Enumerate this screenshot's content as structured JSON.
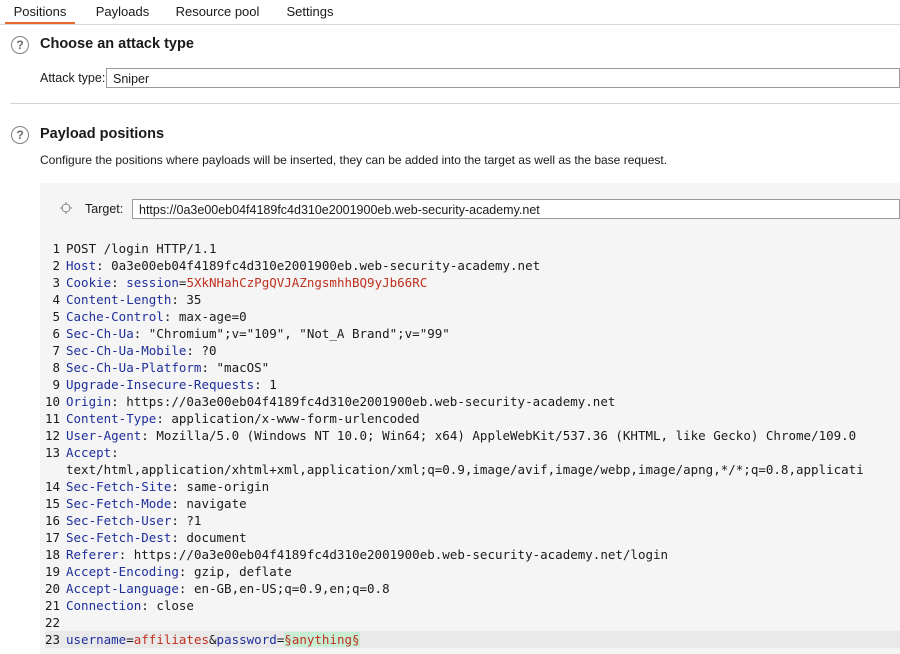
{
  "tabs": [
    {
      "label": "Positions",
      "active": true
    },
    {
      "label": "Payloads",
      "active": false
    },
    {
      "label": "Resource pool",
      "active": false
    },
    {
      "label": "Settings",
      "active": false
    }
  ],
  "help_icon_glyph": "?",
  "attack": {
    "title": "Choose an attack type",
    "type_label": "Attack type:",
    "type_value": "Sniper"
  },
  "positions": {
    "title": "Payload positions",
    "description": "Configure the positions where payloads will be inserted, they can be added into the target as well as the base request.",
    "target_label": "Target:",
    "target_value": "https://0a3e00eb04f4189fc4d310e2001900eb.web-security-academy.net"
  },
  "request_lines": [
    {
      "n": "1",
      "parts": [
        {
          "t": "POST /login HTTP/1.1",
          "c": "v"
        }
      ]
    },
    {
      "n": "2",
      "parts": [
        {
          "t": "Host",
          "c": "k"
        },
        {
          "t": ": 0a3e00eb04f4189fc4d310e2001900eb.web-security-academy.net",
          "c": "v"
        }
      ]
    },
    {
      "n": "3",
      "parts": [
        {
          "t": "Cookie",
          "c": "k"
        },
        {
          "t": ": ",
          "c": "v"
        },
        {
          "t": "session",
          "c": "k"
        },
        {
          "t": "=",
          "c": "v"
        },
        {
          "t": "5XkNHahCzPgQVJAZngsmhhBQ9yJb66RC",
          "c": "red"
        }
      ]
    },
    {
      "n": "4",
      "parts": [
        {
          "t": "Content-Length",
          "c": "k"
        },
        {
          "t": ": 35",
          "c": "v"
        }
      ]
    },
    {
      "n": "5",
      "parts": [
        {
          "t": "Cache-Control",
          "c": "k"
        },
        {
          "t": ": max-age=0",
          "c": "v"
        }
      ]
    },
    {
      "n": "6",
      "parts": [
        {
          "t": "Sec-Ch-Ua",
          "c": "k"
        },
        {
          "t": ": \"Chromium\";v=\"109\", \"Not_A Brand\";v=\"99\"",
          "c": "v"
        }
      ]
    },
    {
      "n": "7",
      "parts": [
        {
          "t": "Sec-Ch-Ua-Mobile",
          "c": "k"
        },
        {
          "t": ": ?0",
          "c": "v"
        }
      ]
    },
    {
      "n": "8",
      "parts": [
        {
          "t": "Sec-Ch-Ua-Platform",
          "c": "k"
        },
        {
          "t": ": \"macOS\"",
          "c": "v"
        }
      ]
    },
    {
      "n": "9",
      "parts": [
        {
          "t": "Upgrade-Insecure-Requests",
          "c": "k"
        },
        {
          "t": ": 1",
          "c": "v"
        }
      ]
    },
    {
      "n": "10",
      "parts": [
        {
          "t": "Origin",
          "c": "k"
        },
        {
          "t": ": https://0a3e00eb04f4189fc4d310e2001900eb.web-security-academy.net",
          "c": "v"
        }
      ]
    },
    {
      "n": "11",
      "parts": [
        {
          "t": "Content-Type",
          "c": "k"
        },
        {
          "t": ": application/x-www-form-urlencoded",
          "c": "v"
        }
      ]
    },
    {
      "n": "12",
      "parts": [
        {
          "t": "User-Agent",
          "c": "k"
        },
        {
          "t": ": Mozilla/5.0 (Windows NT 10.0; Win64; x64) AppleWebKit/537.36 (KHTML, like Gecko) Chrome/109.0",
          "c": "v"
        }
      ]
    },
    {
      "n": "13",
      "parts": [
        {
          "t": "Accept",
          "c": "k"
        },
        {
          "t": ":",
          "c": "v"
        }
      ]
    },
    {
      "n": "",
      "parts": [
        {
          "t": "text/html,application/xhtml+xml,application/xml;q=0.9,image/avif,image/webp,image/apng,*/*;q=0.8,applicati",
          "c": "v"
        }
      ]
    },
    {
      "n": "14",
      "parts": [
        {
          "t": "Sec-Fetch-Site",
          "c": "k"
        },
        {
          "t": ": same-origin",
          "c": "v"
        }
      ]
    },
    {
      "n": "15",
      "parts": [
        {
          "t": "Sec-Fetch-Mode",
          "c": "k"
        },
        {
          "t": ": navigate",
          "c": "v"
        }
      ]
    },
    {
      "n": "16",
      "parts": [
        {
          "t": "Sec-Fetch-User",
          "c": "k"
        },
        {
          "t": ": ?1",
          "c": "v"
        }
      ]
    },
    {
      "n": "17",
      "parts": [
        {
          "t": "Sec-Fetch-Dest",
          "c": "k"
        },
        {
          "t": ": document",
          "c": "v"
        }
      ]
    },
    {
      "n": "18",
      "parts": [
        {
          "t": "Referer",
          "c": "k"
        },
        {
          "t": ": https://0a3e00eb04f4189fc4d310e2001900eb.web-security-academy.net/login",
          "c": "v"
        }
      ]
    },
    {
      "n": "19",
      "parts": [
        {
          "t": "Accept-Encoding",
          "c": "k"
        },
        {
          "t": ": gzip, deflate",
          "c": "v"
        }
      ]
    },
    {
      "n": "20",
      "parts": [
        {
          "t": "Accept-Language",
          "c": "k"
        },
        {
          "t": ": en-GB,en-US;q=0.9,en;q=0.8",
          "c": "v"
        }
      ]
    },
    {
      "n": "21",
      "parts": [
        {
          "t": "Connection",
          "c": "k"
        },
        {
          "t": ": close",
          "c": "v"
        }
      ]
    },
    {
      "n": "22",
      "parts": []
    },
    {
      "n": "23",
      "highlight": true,
      "parts": [
        {
          "t": "username",
          "c": "k"
        },
        {
          "t": "=",
          "c": "v"
        },
        {
          "t": "affiliates",
          "c": "red"
        },
        {
          "t": "&",
          "c": "v"
        },
        {
          "t": "password",
          "c": "k"
        },
        {
          "t": "=",
          "c": "v"
        },
        {
          "t": "§anything§",
          "c": "hl"
        }
      ]
    }
  ]
}
